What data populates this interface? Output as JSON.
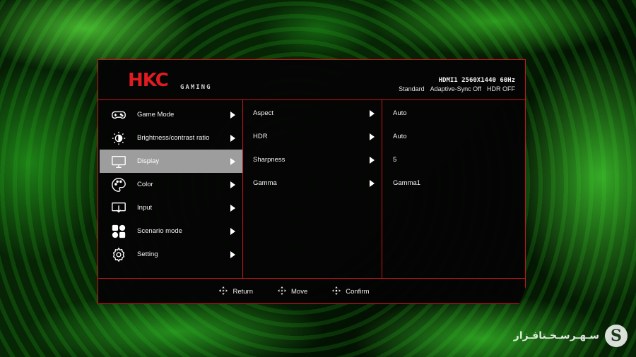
{
  "brand": {
    "logo": "HKC",
    "sub": "GAMING"
  },
  "signal": {
    "info": "HDMI1 2560X1440 60Hz"
  },
  "status": [
    "Standard",
    "Adaptive-Sync Off",
    "HDR OFF"
  ],
  "main_menu": [
    {
      "label": "Game Mode",
      "icon": "gamepad-icon",
      "selected": false
    },
    {
      "label": "Brightness/contrast ratio",
      "icon": "brightness-icon",
      "selected": false
    },
    {
      "label": "Display",
      "icon": "monitor-icon",
      "selected": true
    },
    {
      "label": "Color",
      "icon": "palette-icon",
      "selected": false
    },
    {
      "label": "Input",
      "icon": "input-icon",
      "selected": false
    },
    {
      "label": "Scenario mode",
      "icon": "scenario-icon",
      "selected": false
    },
    {
      "label": "Setting",
      "icon": "gear-icon",
      "selected": false
    }
  ],
  "sub_menu": [
    {
      "label": "Aspect",
      "value": "Auto"
    },
    {
      "label": "HDR",
      "value": "Auto"
    },
    {
      "label": "Sharpness",
      "value": "5"
    },
    {
      "label": "Gamma",
      "value": "Gamma1"
    }
  ],
  "footer": [
    {
      "label": "Return",
      "icon": "dpad-return-icon"
    },
    {
      "label": "Move",
      "icon": "dpad-move-icon"
    },
    {
      "label": "Confirm",
      "icon": "dpad-confirm-icon"
    }
  ],
  "watermark": {
    "text": "سـهـرسـخـتافـزار",
    "logo": "S"
  },
  "colors": {
    "accent": "#c8161c",
    "selected_bg": "#9d9d9d",
    "panel_bg": "#040404"
  }
}
